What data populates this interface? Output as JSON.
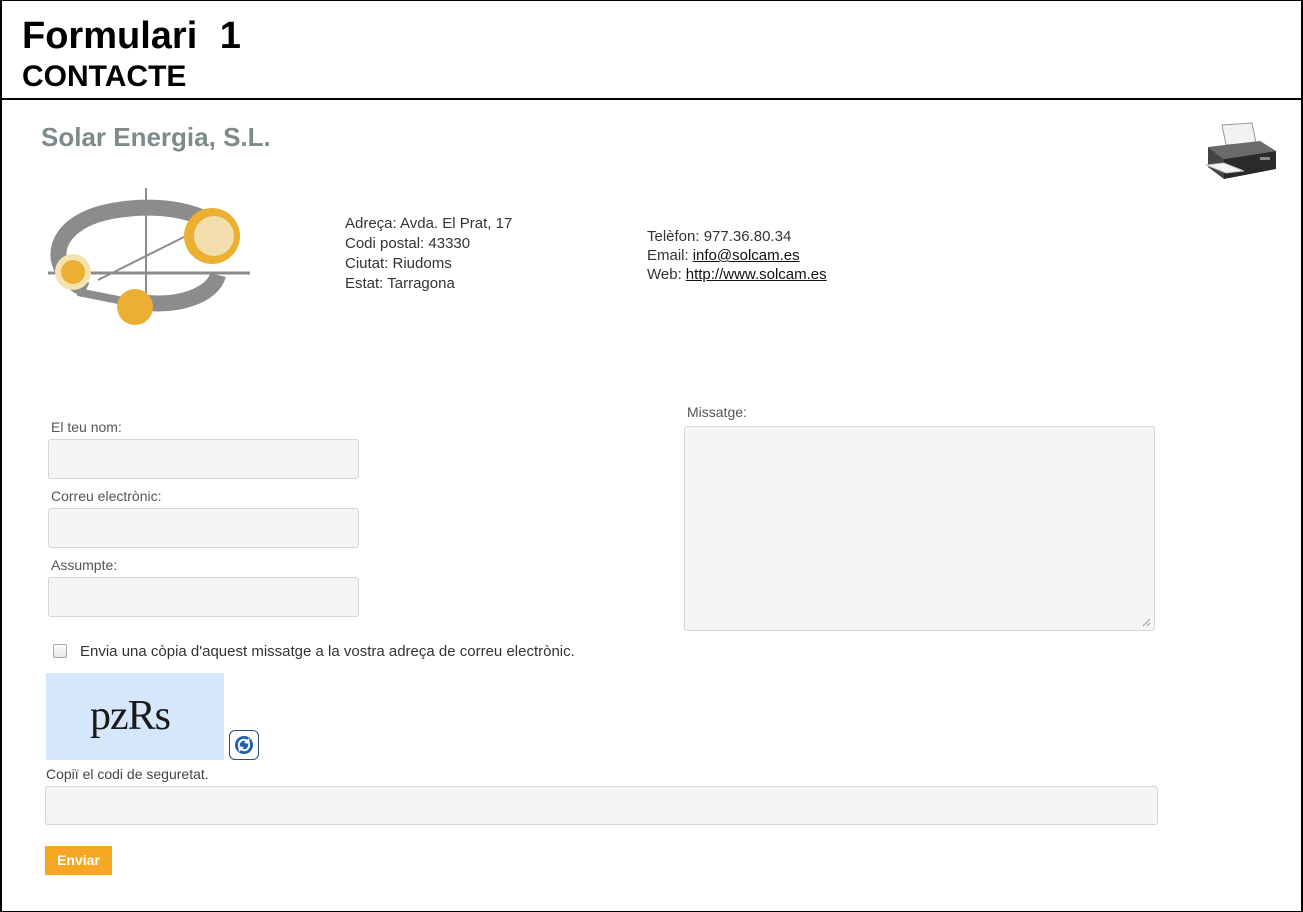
{
  "document": {
    "title": "Formulari  1",
    "subtitle": "CONTACTE"
  },
  "company": {
    "name": "Solar Energia, S.L.",
    "address_lines": [
      "Adreça: Avda. El Prat, 17",
      "Codi postal: 43330",
      "Ciutat: Riudoms",
      "Estat: Tarragona"
    ],
    "phone_label": "Telèfon: 977.36.80.34",
    "email_label": "Email:",
    "email": "info@solcam.es",
    "web_label": "Web:",
    "web": "http://www.solcam.es "
  },
  "form": {
    "name_label": "El teu nom:",
    "email_label": "Correu electrònic:",
    "subject_label": "Assumpte:",
    "message_label": "Missatge:",
    "copy_label": "Envia una còpia d'aquest missatge a la vostra adreça de correu electrònic.",
    "captcha_text": "pzRs",
    "security_label": "Copiï el codi de seguretat.",
    "submit_label": "Enviar"
  },
  "icons": {
    "printer": "printer-icon",
    "refresh": "refresh-icon",
    "logo": "solar-logo"
  },
  "colors": {
    "accent": "#f5a623",
    "company_name": "#7d8b8b",
    "captcha_bg": "#d7e7fb",
    "logo_ring": "#8c8c8c",
    "logo_sun": "#ebb032"
  }
}
